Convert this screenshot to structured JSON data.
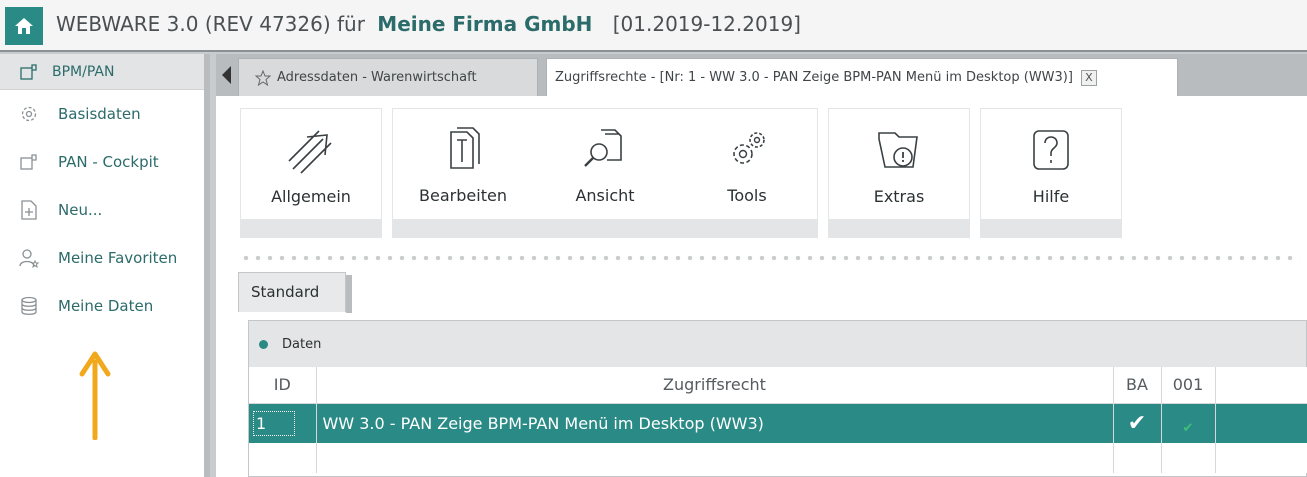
{
  "app": {
    "title_prefix": "WEBWARE 3.0 (REV 47326) für",
    "company": "Meine Firma GmbH",
    "period": "[01.2019-12.2019]"
  },
  "colors": {
    "accent": "#2a8a85",
    "sidebar_text": "#2b6b6a",
    "chrome": "#b9bcbe",
    "annotation_arrow": "#f2a81d"
  },
  "sidebar": {
    "header": {
      "label": "BPM/PAN",
      "icon": "cockpit-icon"
    },
    "items": [
      {
        "label": "Basisdaten",
        "icon": "gear-icon"
      },
      {
        "label": "PAN - Cockpit",
        "icon": "cockpit-icon"
      },
      {
        "label": "Neu...",
        "icon": "new-document-icon"
      },
      {
        "label": "Meine Favoriten",
        "icon": "user-star-icon"
      },
      {
        "label": "Meine Daten",
        "icon": "database-icon"
      }
    ]
  },
  "tabs": [
    {
      "label": "Adressdaten - Warenwirtschaft",
      "icon": "star-icon",
      "active": false
    },
    {
      "label": "Zugriffsrechte - [Nr: 1 - WW 3.0 - PAN Zeige BPM-PAN Menü im Desktop (WW3)]",
      "close": "X",
      "active": true
    }
  ],
  "toolbar": [
    {
      "label": "Allgemein",
      "icon": "arrow-up-right-icon"
    },
    {
      "label": "Bearbeiten",
      "icon": "documents-icon"
    },
    {
      "label": "Ansicht",
      "icon": "search-document-icon"
    },
    {
      "label": "Tools",
      "icon": "gears-icon"
    },
    {
      "label": "Extras",
      "icon": "folder-alert-icon"
    },
    {
      "label": "Hilfe",
      "icon": "help-icon"
    }
  ],
  "view_tab": "Standard",
  "panel": {
    "title": "Daten",
    "columns": [
      "ID",
      "Zugriffsrecht",
      "BA",
      "001"
    ],
    "rows": [
      {
        "id": "1",
        "recht": "WW 3.0 - PAN Zeige BPM-PAN Menü im Desktop (WW3)",
        "ba": "✔",
        "c001": "✔"
      }
    ]
  }
}
